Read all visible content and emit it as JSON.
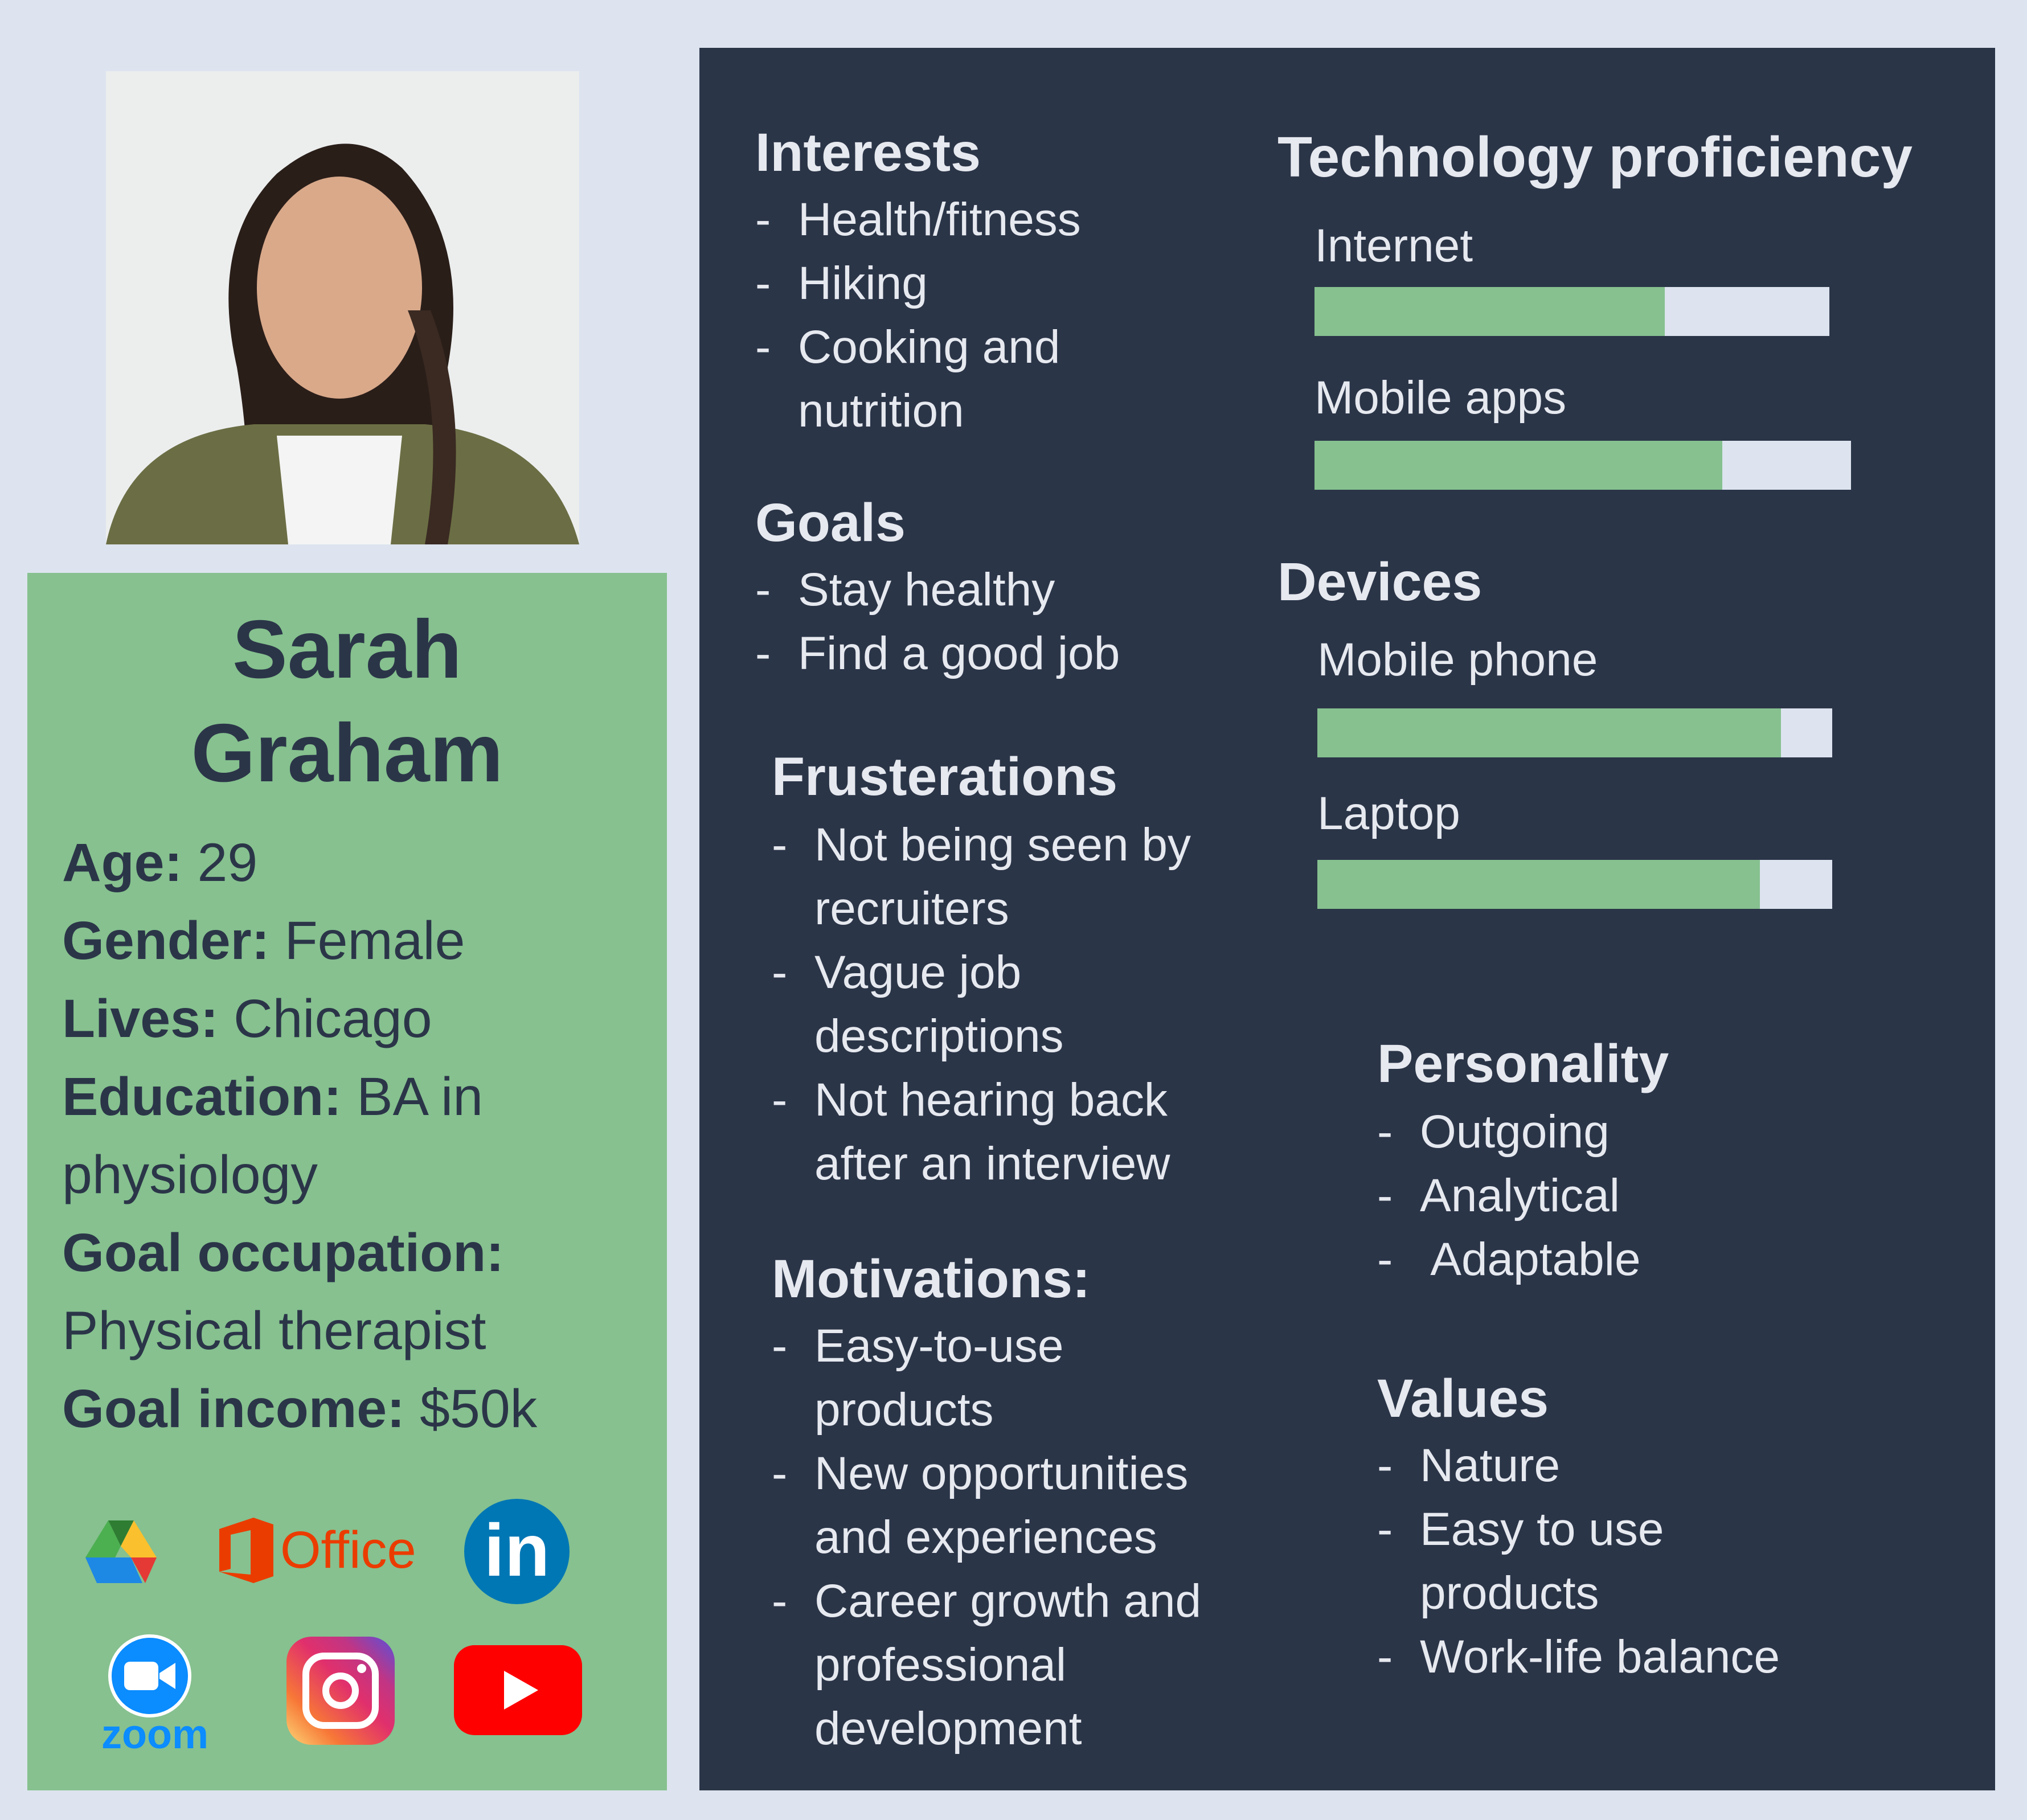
{
  "profile": {
    "first_name": "Sarah",
    "last_name": "Graham",
    "details": [
      {
        "label": "Age:",
        "value": " 29"
      },
      {
        "label": "Gender:",
        "value": " Female"
      },
      {
        "label": "Lives:",
        "value": " Chicago"
      },
      {
        "label": "Education:",
        "value": " BA in physiology"
      },
      {
        "label": "Goal occupation:",
        "value": " Physical therapist"
      },
      {
        "label": "Goal income:",
        "value": " $50k"
      }
    ],
    "apps": [
      "google-drive-icon",
      "office-icon",
      "linkedin-icon",
      "zoom-icon",
      "instagram-icon",
      "youtube-icon"
    ],
    "office_text": "Office",
    "zoom_text": "zoom",
    "linkedin_text": "in"
  },
  "interests": {
    "title": "Interests",
    "items": [
      "Health/fitness",
      "Hiking",
      "Cooking and nutrition"
    ]
  },
  "goals": {
    "title": "Goals",
    "items": [
      "Stay healthy",
      "Find a good job"
    ]
  },
  "frustrations": {
    "title": "Frusterations",
    "items": [
      "Not being seen by recruiters",
      "Vague job descriptions",
      "Not hearing back after an interview"
    ]
  },
  "motivations": {
    "title": "Motivations:",
    "items": [
      "Easy-to-use products",
      "New opportunities and experiences",
      "Career growth and professional development"
    ]
  },
  "tech": {
    "title": "Technology proficiency",
    "items": [
      {
        "label": "Internet",
        "percent": 68
      },
      {
        "label": "Mobile apps",
        "percent": 76
      }
    ]
  },
  "devices": {
    "title": "Devices",
    "items": [
      {
        "label": "Mobile phone",
        "percent": 90
      },
      {
        "label": "Laptop",
        "percent": 86
      }
    ]
  },
  "personality": {
    "title": "Personality",
    "items": [
      "Outgoing",
      "Analytical",
      " Adaptable"
    ]
  },
  "values": {
    "title": "Values",
    "items": [
      "Nature",
      "Easy to use products",
      "Work-life balance"
    ]
  },
  "colors": {
    "background": "#dde4ef",
    "panel": "#2b3548",
    "accent": "#86c18f"
  }
}
